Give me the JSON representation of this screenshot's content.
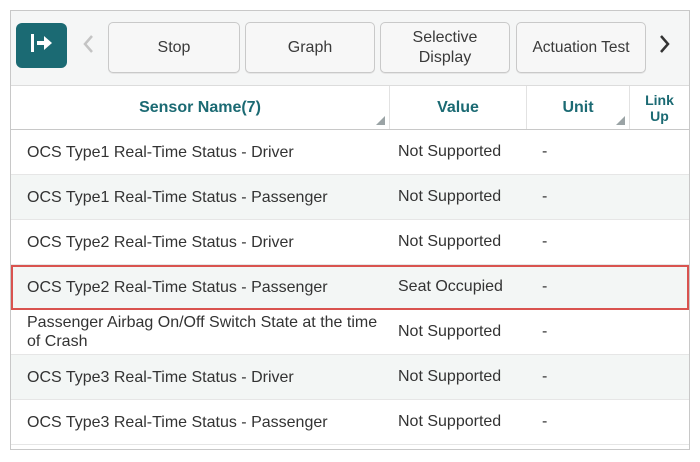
{
  "toolbar": {
    "buttons": [
      "Stop",
      "Graph",
      "Selective Display",
      "Actuation Test"
    ],
    "selective_line1": "Selective",
    "selective_line2": "Display",
    "accent_color": "#1b6a73"
  },
  "table": {
    "headers": {
      "name": "Sensor Name(7)",
      "value": "Value",
      "unit": "Unit",
      "link_line1": "Link",
      "link_line2": "Up"
    },
    "rows": [
      {
        "name": "OCS Type1 Real-Time Status - Driver",
        "value": "Not Supported",
        "unit": "-"
      },
      {
        "name": "OCS Type1 Real-Time Status - Passenger",
        "value": "Not Supported",
        "unit": "-"
      },
      {
        "name": "OCS Type2 Real-Time Status - Driver",
        "value": "Not Supported",
        "unit": "-"
      },
      {
        "name": "OCS Type2 Real-Time Status - Passenger",
        "value": "Seat Occupied",
        "unit": "-"
      },
      {
        "name": "Passenger Airbag On/Off Switch State at the time of Crash",
        "value": "Not Supported",
        "unit": "-"
      },
      {
        "name": "OCS Type3 Real-Time Status - Driver",
        "value": "Not Supported",
        "unit": "-"
      },
      {
        "name": "OCS Type3 Real-Time Status - Passenger",
        "value": "Not Supported",
        "unit": "-"
      }
    ],
    "highlight_color": "#d9534f"
  }
}
